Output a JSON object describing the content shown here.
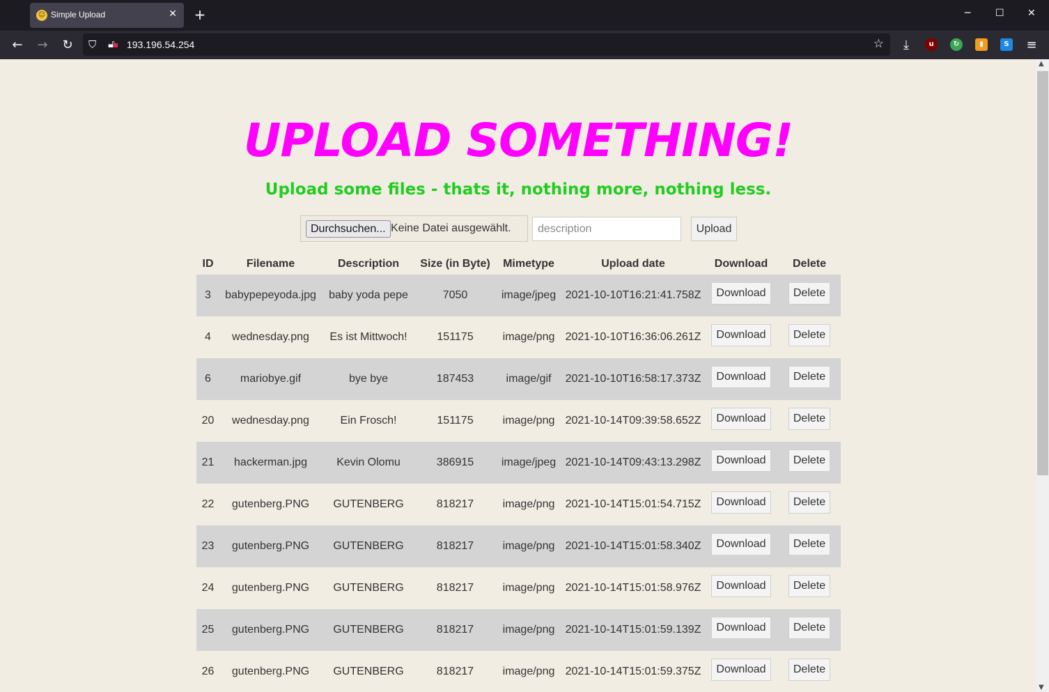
{
  "browser": {
    "tab_title": "Simple Upload",
    "new_tab": "+",
    "url": "193.196.54.254",
    "colors": {
      "frame": "#1c1b22",
      "toolbar": "#2b2a33",
      "active_tab": "#42414d"
    }
  },
  "page": {
    "heading": "UPLOAD SOMETHING!",
    "subheading": "Upload some files - thats it, nothing more, nothing less.",
    "colors": {
      "background": "#f2ede2",
      "heading": "#ff00ff",
      "subheading": "#22cc22",
      "row_stripe": "#d4d4d4"
    },
    "form": {
      "browse_label": "Durchsuchen...",
      "no_file_label": "Keine Datei ausgewählt.",
      "description_placeholder": "description",
      "description_value": "",
      "upload_label": "Upload"
    },
    "table": {
      "headers": [
        "ID",
        "Filename",
        "Description",
        "Size (in Byte)",
        "Mimetype",
        "Upload date",
        "Download",
        "Delete"
      ],
      "download_label": "Download",
      "delete_label": "Delete",
      "rows": [
        {
          "id": "3",
          "filename": "babypepeyoda.jpg",
          "description": "baby yoda pepe",
          "size": "7050",
          "mimetype": "image/jpeg",
          "date": "2021-10-10T16:21:41.758Z"
        },
        {
          "id": "4",
          "filename": "wednesday.png",
          "description": "Es ist Mittwoch!",
          "size": "151175",
          "mimetype": "image/png",
          "date": "2021-10-10T16:36:06.261Z"
        },
        {
          "id": "6",
          "filename": "mariobye.gif",
          "description": "bye bye",
          "size": "187453",
          "mimetype": "image/gif",
          "date": "2021-10-10T16:58:17.373Z"
        },
        {
          "id": "20",
          "filename": "wednesday.png",
          "description": "Ein Frosch!",
          "size": "151175",
          "mimetype": "image/png",
          "date": "2021-10-14T09:39:58.652Z"
        },
        {
          "id": "21",
          "filename": "hackerman.jpg",
          "description": "Kevin Olomu",
          "size": "386915",
          "mimetype": "image/jpeg",
          "date": "2021-10-14T09:43:13.298Z"
        },
        {
          "id": "22",
          "filename": "gutenberg.PNG",
          "description": "GUTENBERG",
          "size": "818217",
          "mimetype": "image/png",
          "date": "2021-10-14T15:01:54.715Z"
        },
        {
          "id": "23",
          "filename": "gutenberg.PNG",
          "description": "GUTENBERG",
          "size": "818217",
          "mimetype": "image/png",
          "date": "2021-10-14T15:01:58.340Z"
        },
        {
          "id": "24",
          "filename": "gutenberg.PNG",
          "description": "GUTENBERG",
          "size": "818217",
          "mimetype": "image/png",
          "date": "2021-10-14T15:01:58.976Z"
        },
        {
          "id": "25",
          "filename": "gutenberg.PNG",
          "description": "GUTENBERG",
          "size": "818217",
          "mimetype": "image/png",
          "date": "2021-10-14T15:01:59.139Z"
        },
        {
          "id": "26",
          "filename": "gutenberg.PNG",
          "description": "GUTENBERG",
          "size": "818217",
          "mimetype": "image/png",
          "date": "2021-10-14T15:01:59.375Z"
        }
      ]
    }
  },
  "icons": {
    "tab_favicon": "nerd-face-icon",
    "back": "back-arrow-icon",
    "forward": "forward-arrow-icon",
    "reload": "reload-icon",
    "tracking": "shield-icon",
    "insecure": "insecure-lock-icon",
    "bookmark": "star-icon",
    "downloads": "download-icon",
    "menu": "hamburger-menu-icon"
  }
}
